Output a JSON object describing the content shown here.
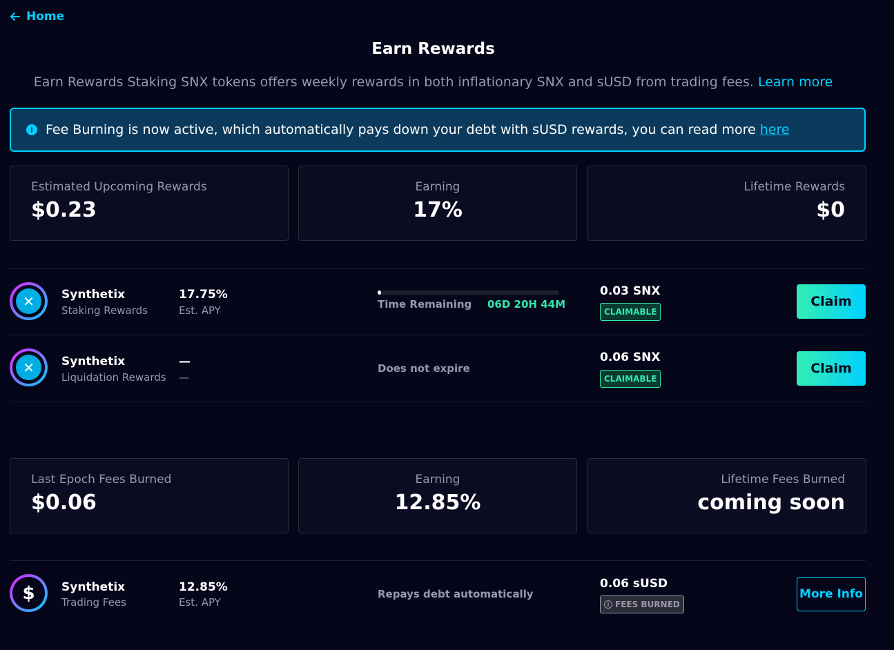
{
  "nav": {
    "home_label": "Home"
  },
  "header": {
    "title": "Earn Rewards",
    "subtitle": "Earn Rewards Staking SNX tokens offers weekly rewards in both inflationary SNX and sUSD from trading fees.",
    "learn_more": "Learn more"
  },
  "alert": {
    "text": "Fee Burning is now active, which automatically pays down your debt with sUSD rewards, you can read more",
    "link": "here"
  },
  "rewards_stats": [
    {
      "label": "Estimated Upcoming Rewards",
      "value": "$0.23"
    },
    {
      "label": "Earning",
      "value": "17%"
    },
    {
      "label": "Lifetime Rewards",
      "value": "$0"
    }
  ],
  "rewards_rows": [
    {
      "name": "Synthetix",
      "sub": "Staking Rewards",
      "apy": "17.75%",
      "apy_label": "Est. APY",
      "time_label": "Time Remaining",
      "time_value": "06D 20H 44M",
      "progress": 0.01,
      "amount": "0.03 SNX",
      "badge": "CLAIMABLE",
      "button": "Claim"
    },
    {
      "name": "Synthetix",
      "sub": "Liquidation Rewards",
      "apy": "—",
      "apy_label": "—",
      "status": "Does not expire",
      "amount": "0.06 SNX",
      "badge": "CLAIMABLE",
      "button": "Claim"
    }
  ],
  "fees_stats": [
    {
      "label": "Last Epoch Fees Burned",
      "value": "$0.06"
    },
    {
      "label": "Earning",
      "value": "12.85%"
    },
    {
      "label": "Lifetime Fees Burned",
      "value": "coming soon"
    }
  ],
  "fees_row": {
    "name": "Synthetix",
    "sub": "Trading Fees",
    "apy": "12.85%",
    "apy_label": "Est. APY",
    "status": "Repays debt automatically",
    "amount": "0.06 sUSD",
    "badge": "FEES BURNED",
    "button": "More Info"
  },
  "colors": {
    "background": "#06061b",
    "accent": "#00d1ff",
    "success": "#31e8ab",
    "muted": "#9999ac"
  }
}
